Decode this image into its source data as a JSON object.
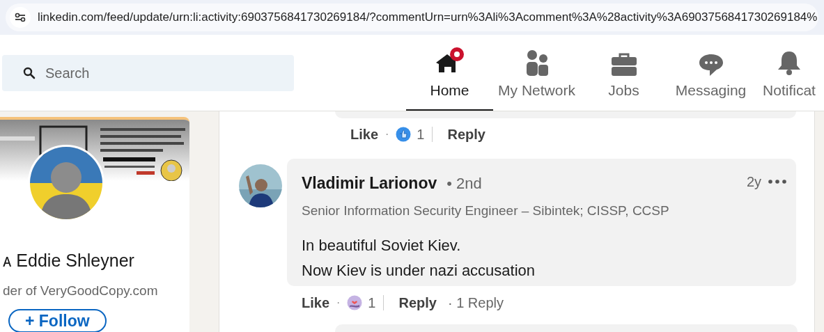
{
  "address_bar": {
    "url": "linkedin.com/feed/update/urn:li:activity:6903756841730269184/?commentUrn=urn%3Ali%3Acomment%3A%28activity%3A6903756841730269184%"
  },
  "search": {
    "placeholder": "Search"
  },
  "nav": [
    {
      "label": "Home",
      "kind": "home",
      "selected": true,
      "notification": true
    },
    {
      "label": "My Network",
      "kind": "network",
      "selected": false,
      "notification": false
    },
    {
      "label": "Jobs",
      "kind": "jobs",
      "selected": false,
      "notification": false
    },
    {
      "label": "Messaging",
      "kind": "messaging",
      "selected": false,
      "notification": false
    },
    {
      "label": "Notificat",
      "kind": "notifications",
      "selected": false,
      "notification": false
    }
  ],
  "profile_card": {
    "name": "ᴀ Eddie Shleyner",
    "headline": "der of VeryGoodCopy.com",
    "follow_button": "+ Follow"
  },
  "comments": [
    {
      "like": "Like",
      "separator": "·",
      "reaction": {
        "kind": "like"
      },
      "reaction_count": "1",
      "reply": "Reply"
    },
    {
      "author": "Vladimir Larionov",
      "degree": "• 2nd",
      "headline": "Senior Information Security Engineer – Sibintek; CISSP, CCSP",
      "time": "2y",
      "text": [
        "In beautiful Soviet Kiev.",
        "Now Kiev is under nazi accusation"
      ],
      "like": "Like",
      "separator": "·",
      "reaction": {
        "kind": "love"
      },
      "reaction_count": "1",
      "reply": "Reply",
      "replies": "· 1 Reply"
    }
  ]
}
